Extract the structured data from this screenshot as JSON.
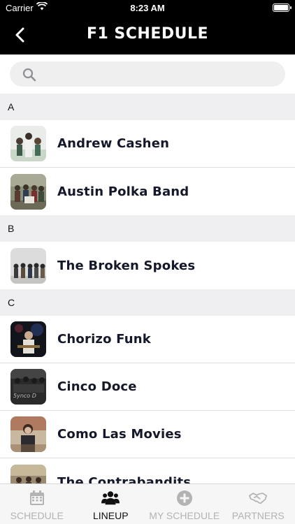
{
  "status_bar": {
    "carrier": "Carrier",
    "time": "8:23 AM"
  },
  "header": {
    "title": "F1 SCHEDULE"
  },
  "search": {
    "placeholder": ""
  },
  "sections": [
    {
      "letter": "A",
      "items": [
        "Andrew Cashen",
        "Austin Polka Band"
      ]
    },
    {
      "letter": "B",
      "items": [
        "The Broken Spokes"
      ]
    },
    {
      "letter": "C",
      "items": [
        "Chorizo Funk",
        "Cinco Doce",
        "Como Las Movies",
        "The Contrabandits"
      ]
    }
  ],
  "tabs": [
    {
      "label": "SCHEDULE",
      "icon": "calendar-icon",
      "active": false
    },
    {
      "label": "LINEUP",
      "icon": "people-icon",
      "active": true
    },
    {
      "label": "MY SCHEDULE",
      "icon": "plus-circle-icon",
      "active": false
    },
    {
      "label": "PARTNERS",
      "icon": "handshake-icon",
      "active": false
    }
  ],
  "colors": {
    "header_bg": "#000000",
    "active_tab": "#111111",
    "inactive_tab": "#b3b3b3",
    "section_bg": "#efeff1",
    "name_text": "#14182a"
  }
}
